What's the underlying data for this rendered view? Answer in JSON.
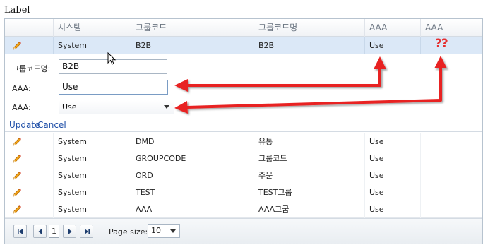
{
  "page": {
    "label": "Label"
  },
  "grid": {
    "columns": [
      "",
      "시스템",
      "그룹코드",
      "그룹코드명",
      "AAA",
      "AAA"
    ],
    "selected_row": {
      "system": "System",
      "code": "B2B",
      "name": "B2B",
      "aaa": "Use",
      "aaa2": ""
    },
    "edit_form": {
      "group_name_label": "그룹코드명:",
      "group_name_value": "B2B",
      "aaa_text_label": "AAA:",
      "aaa_text_value": "Use",
      "aaa_select_label": "AAA:",
      "aaa_select_value": "Use",
      "update_link": "Update",
      "cancel_link": "Cancel"
    },
    "rows": [
      {
        "system": "System",
        "code": "DMD",
        "name": "유통",
        "aaa": "Use",
        "aaa2": ""
      },
      {
        "system": "System",
        "code": "GROUPCODE",
        "name": "그룹코드",
        "aaa": "Use",
        "aaa2": ""
      },
      {
        "system": "System",
        "code": "ORD",
        "name": "주문",
        "aaa": "Use",
        "aaa2": ""
      },
      {
        "system": "System",
        "code": "TEST",
        "name": "TEST그룹",
        "aaa": "Use",
        "aaa2": ""
      },
      {
        "system": "System",
        "code": "AAA",
        "name": "AAA그굽",
        "aaa": "Use",
        "aaa2": ""
      }
    ],
    "pager": {
      "current_page": "1",
      "page_size_label": "Page size:",
      "page_size_value": "10"
    }
  },
  "annotation": {
    "text": "??",
    "color": "#e53030"
  },
  "colors": {
    "selected_row": "#dbe8f7",
    "link": "#1f4fa8",
    "arrow": "#e82424"
  }
}
